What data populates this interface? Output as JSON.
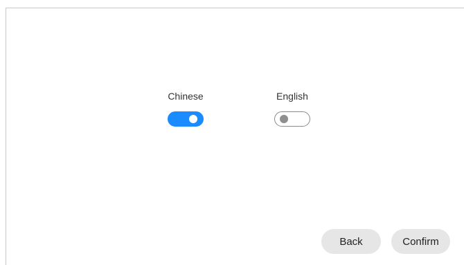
{
  "languages": {
    "chinese": {
      "label": "Chinese",
      "enabled": true
    },
    "english": {
      "label": "English",
      "enabled": false
    }
  },
  "buttons": {
    "back_label": "Back",
    "confirm_label": "Confirm"
  },
  "colors": {
    "toggle_on": "#1a8cff",
    "toggle_off_border": "#8a8a8a",
    "button_bg": "#e6e6e6"
  }
}
